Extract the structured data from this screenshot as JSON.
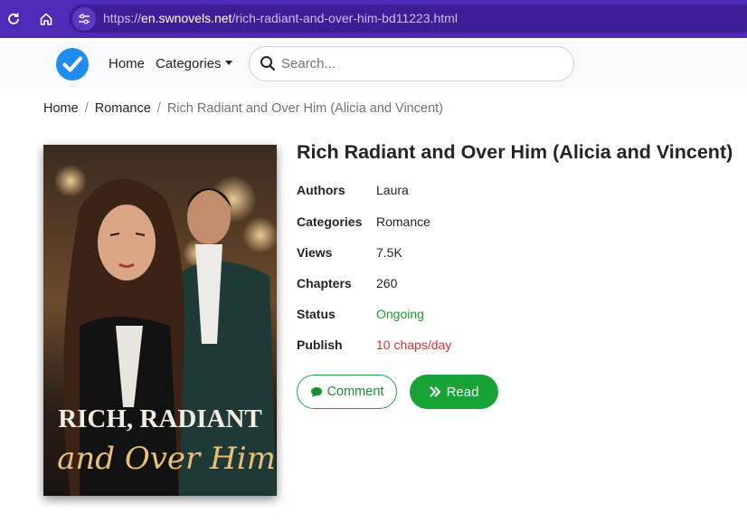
{
  "browser": {
    "url_protocol": "https://",
    "url_host": "en.swnovels.net",
    "url_path": "/rich-radiant-and-over-him-bd11223.html",
    "icons": [
      "reload-icon",
      "home-icon",
      "site-info-icon"
    ]
  },
  "navbar": {
    "home_label": "Home",
    "categories_label": "Categories",
    "search_placeholder": "Search...",
    "logo_icon": "checkmark-badge-icon"
  },
  "breadcrumb": {
    "items": [
      "Home",
      "Romance"
    ],
    "current": "Rich Radiant and Over Him (Alicia and Vincent)"
  },
  "book": {
    "title": "Rich Radiant and Over Him (Alicia and Vincent)",
    "cover_text_line1": "RICH, RADIANT",
    "cover_text_line2": "and Over Him",
    "info": [
      {
        "label": "Authors",
        "value": "Laura"
      },
      {
        "label": "Categories",
        "value": "Romance"
      },
      {
        "label": "Views",
        "value": "7.5K"
      },
      {
        "label": "Chapters",
        "value": "260"
      },
      {
        "label": "Status",
        "value": "Ongoing"
      },
      {
        "label": "Publish",
        "value": "10 chaps/day"
      }
    ],
    "comment_label": "Comment",
    "read_label": "Read"
  },
  "colors": {
    "browser_bar": "#4f29b8",
    "accent_green": "#17a336",
    "status_green": "#1e9e2e",
    "publish_red": "#d9302f",
    "logo_blue": "#1e8cf0"
  }
}
